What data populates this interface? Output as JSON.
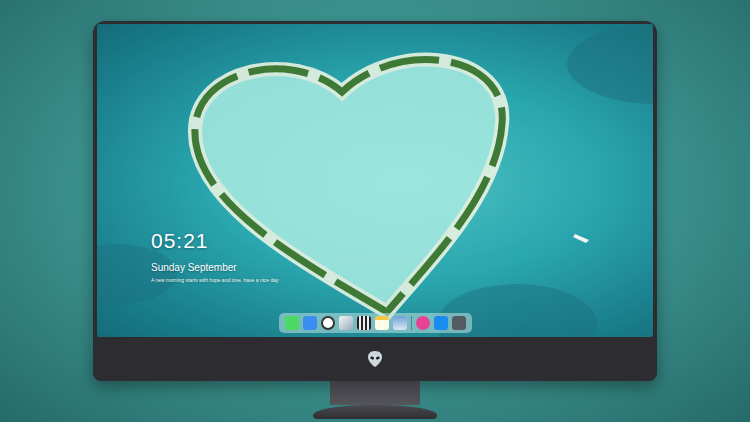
{
  "lock_screen": {
    "time": "05:21",
    "date": "Sunday September",
    "message": "A new morning starts with hope and love, have a nice day"
  }
}
